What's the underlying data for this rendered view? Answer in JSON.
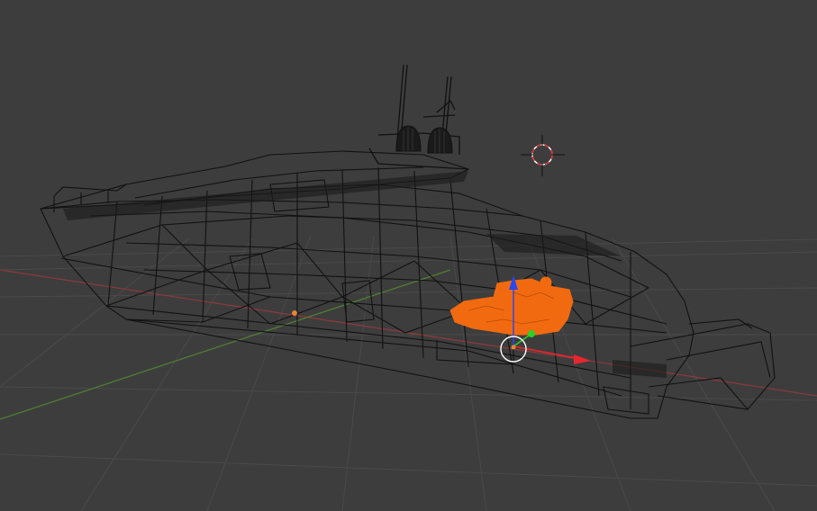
{
  "viewport": {
    "background": "#3d3d3d",
    "grid_color": "#4a4a4a",
    "x_axis_color": "#8b3a3a",
    "y_axis_color": "#4f7f33",
    "wire_color": "#111111",
    "selected_color": "#f26a10"
  },
  "objects": {
    "yacht": {
      "icon": "wireframe-mesh"
    },
    "selected_engine": {
      "icon": "selected-mesh"
    }
  },
  "gizmo": {
    "x_color": "#e8262e",
    "y_color": "#2bd12b",
    "z_color": "#2b47f0",
    "pivot_color": "#ffffff"
  },
  "cursor_3d": {
    "icon": "3d-cursor-icon",
    "colors": [
      "#d62d2d",
      "#ffffff"
    ]
  }
}
